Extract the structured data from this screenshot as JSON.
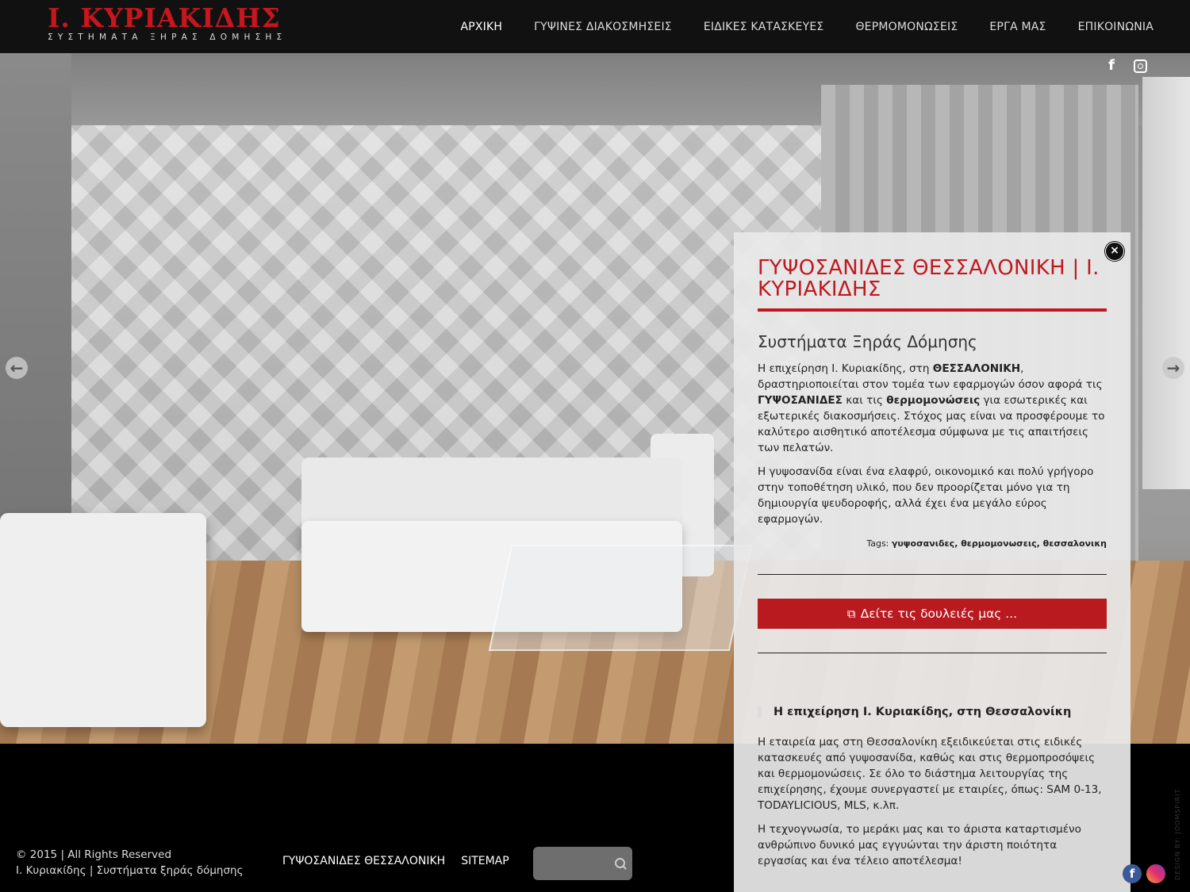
{
  "header": {
    "logo_main": "Ι. ΚΥΡΙΑΚΙΔΗΣ",
    "logo_sub": "ΣΥΣΤΗΜΑΤΑ ΞΗΡΑΣ ΔΟΜΗΣΗΣ",
    "nav": [
      {
        "label": "ΑΡΧΙΚΗ",
        "active": true
      },
      {
        "label": "ΓΥΨΙΝΕΣ ΔΙΑΚΟΣΜΗΣΕΙΣ"
      },
      {
        "label": "ΕΙΔΙΚΕΣ ΚΑΤΑΣΚΕΥΕΣ"
      },
      {
        "label": "ΘΕΡΜΟΜΟΝΩΣΕΙΣ"
      },
      {
        "label": "ΕΡΓΑ ΜΑΣ"
      },
      {
        "label": "ΕΠΙΚΟΙΝΩΝΙΑ"
      }
    ]
  },
  "social_top": {
    "facebook": "f",
    "instagram_icon": "instagram-icon"
  },
  "slider": {
    "prev_icon": "arrow-left-icon",
    "next_icon": "arrow-right-icon"
  },
  "panel": {
    "close": "×",
    "title": "ΓΥΨΟΣΑΝΙΔΕΣ ΘΕΣΣΑΛΟΝΙΚΗ | Ι. ΚΥΡΙΑΚΙΔΗΣ",
    "subtitle": "Συστήματα Ξηράς Δόμησης",
    "p1_a": "Η επιχείρηση Ι. Κυριακίδης, στη ",
    "p1_b": "ΘΕΣΣΑΛΟΝΙΚΗ",
    "p1_c": ", δραστηριοποιείται στον τομέα των εφαρμογών όσον αφορά τις ",
    "p1_d": "ΓΥΨΟΣΑΝΙΔΕΣ",
    "p1_e": " και τις ",
    "p1_f": "θερμομονώσεις",
    "p1_g": " για εσωτερικές και εξωτερικές διακοσμήσεις. Στόχος μας είναι να προσφέρουμε το καλύτερο αισθητικό αποτέλεσμα σύμφωνα με τις απαιτήσεις των πελατών.",
    "p2": "Η γυψοσανίδα είναι ένα ελαφρύ, οικονομικό και πολύ γρήγορο στην τοποθέτηση υλικό, που δεν προορίζεται μόνο για τη δημιουργία ψευδοροφής, αλλά έχει ένα μεγάλο εύρος εφαρμογών.",
    "tags_label": "Tags: ",
    "tags": [
      {
        "label": "γυψοσανιδες",
        "sep": ", "
      },
      {
        "label": "θερμομονωσεις",
        "sep": ", "
      },
      {
        "label": "θεσσαλονικη",
        "sep": ""
      }
    ],
    "cta_label": "Δείτε τις δουλειές μας ...",
    "h3": "Η επιχείρηση Ι. Κυριακίδης, στη Θεσσαλονίκη",
    "p3": "Η εταιρεία μας στη Θεσσαλονίκη εξειδικεύεται στις ειδικές κατασκευές από γυψοσανίδα, καθώς και στις θερμοπροσόψεις και θερμομονώσεις. Σε όλο το διάστημα λειτουργίας της επιχείρησης, έχουμε συνεργαστεί με εταιρίες, όπως: SAM 0-13, TODAYLICIOUS, MLS, κ.λπ.",
    "p4": "Η τεχνογνωσία, το μεράκι μας και το άριστα καταρτισμένο ανθρώπινο δυνικό μας εγγυώνται την άριστη ποιότητα εργασίας και ένα τέλειο αποτέλεσμα!"
  },
  "footer": {
    "copyright": "© 2015 | All Rights Reserved",
    "company": "Ι. Κυριακίδης | Συστήματα ξηράς δόμησης",
    "links": [
      "ΓΥΨΟΣΑΝΙΔΕΣ ΘΕΣΣΑΛΟΝΙΚΗ",
      "SITEMAP"
    ],
    "search_placeholder": "",
    "credit": "DESIGN BY: JOOMSPIRIT"
  },
  "colors": {
    "brand_red": "#c0181f",
    "header_bg": "#111111"
  }
}
